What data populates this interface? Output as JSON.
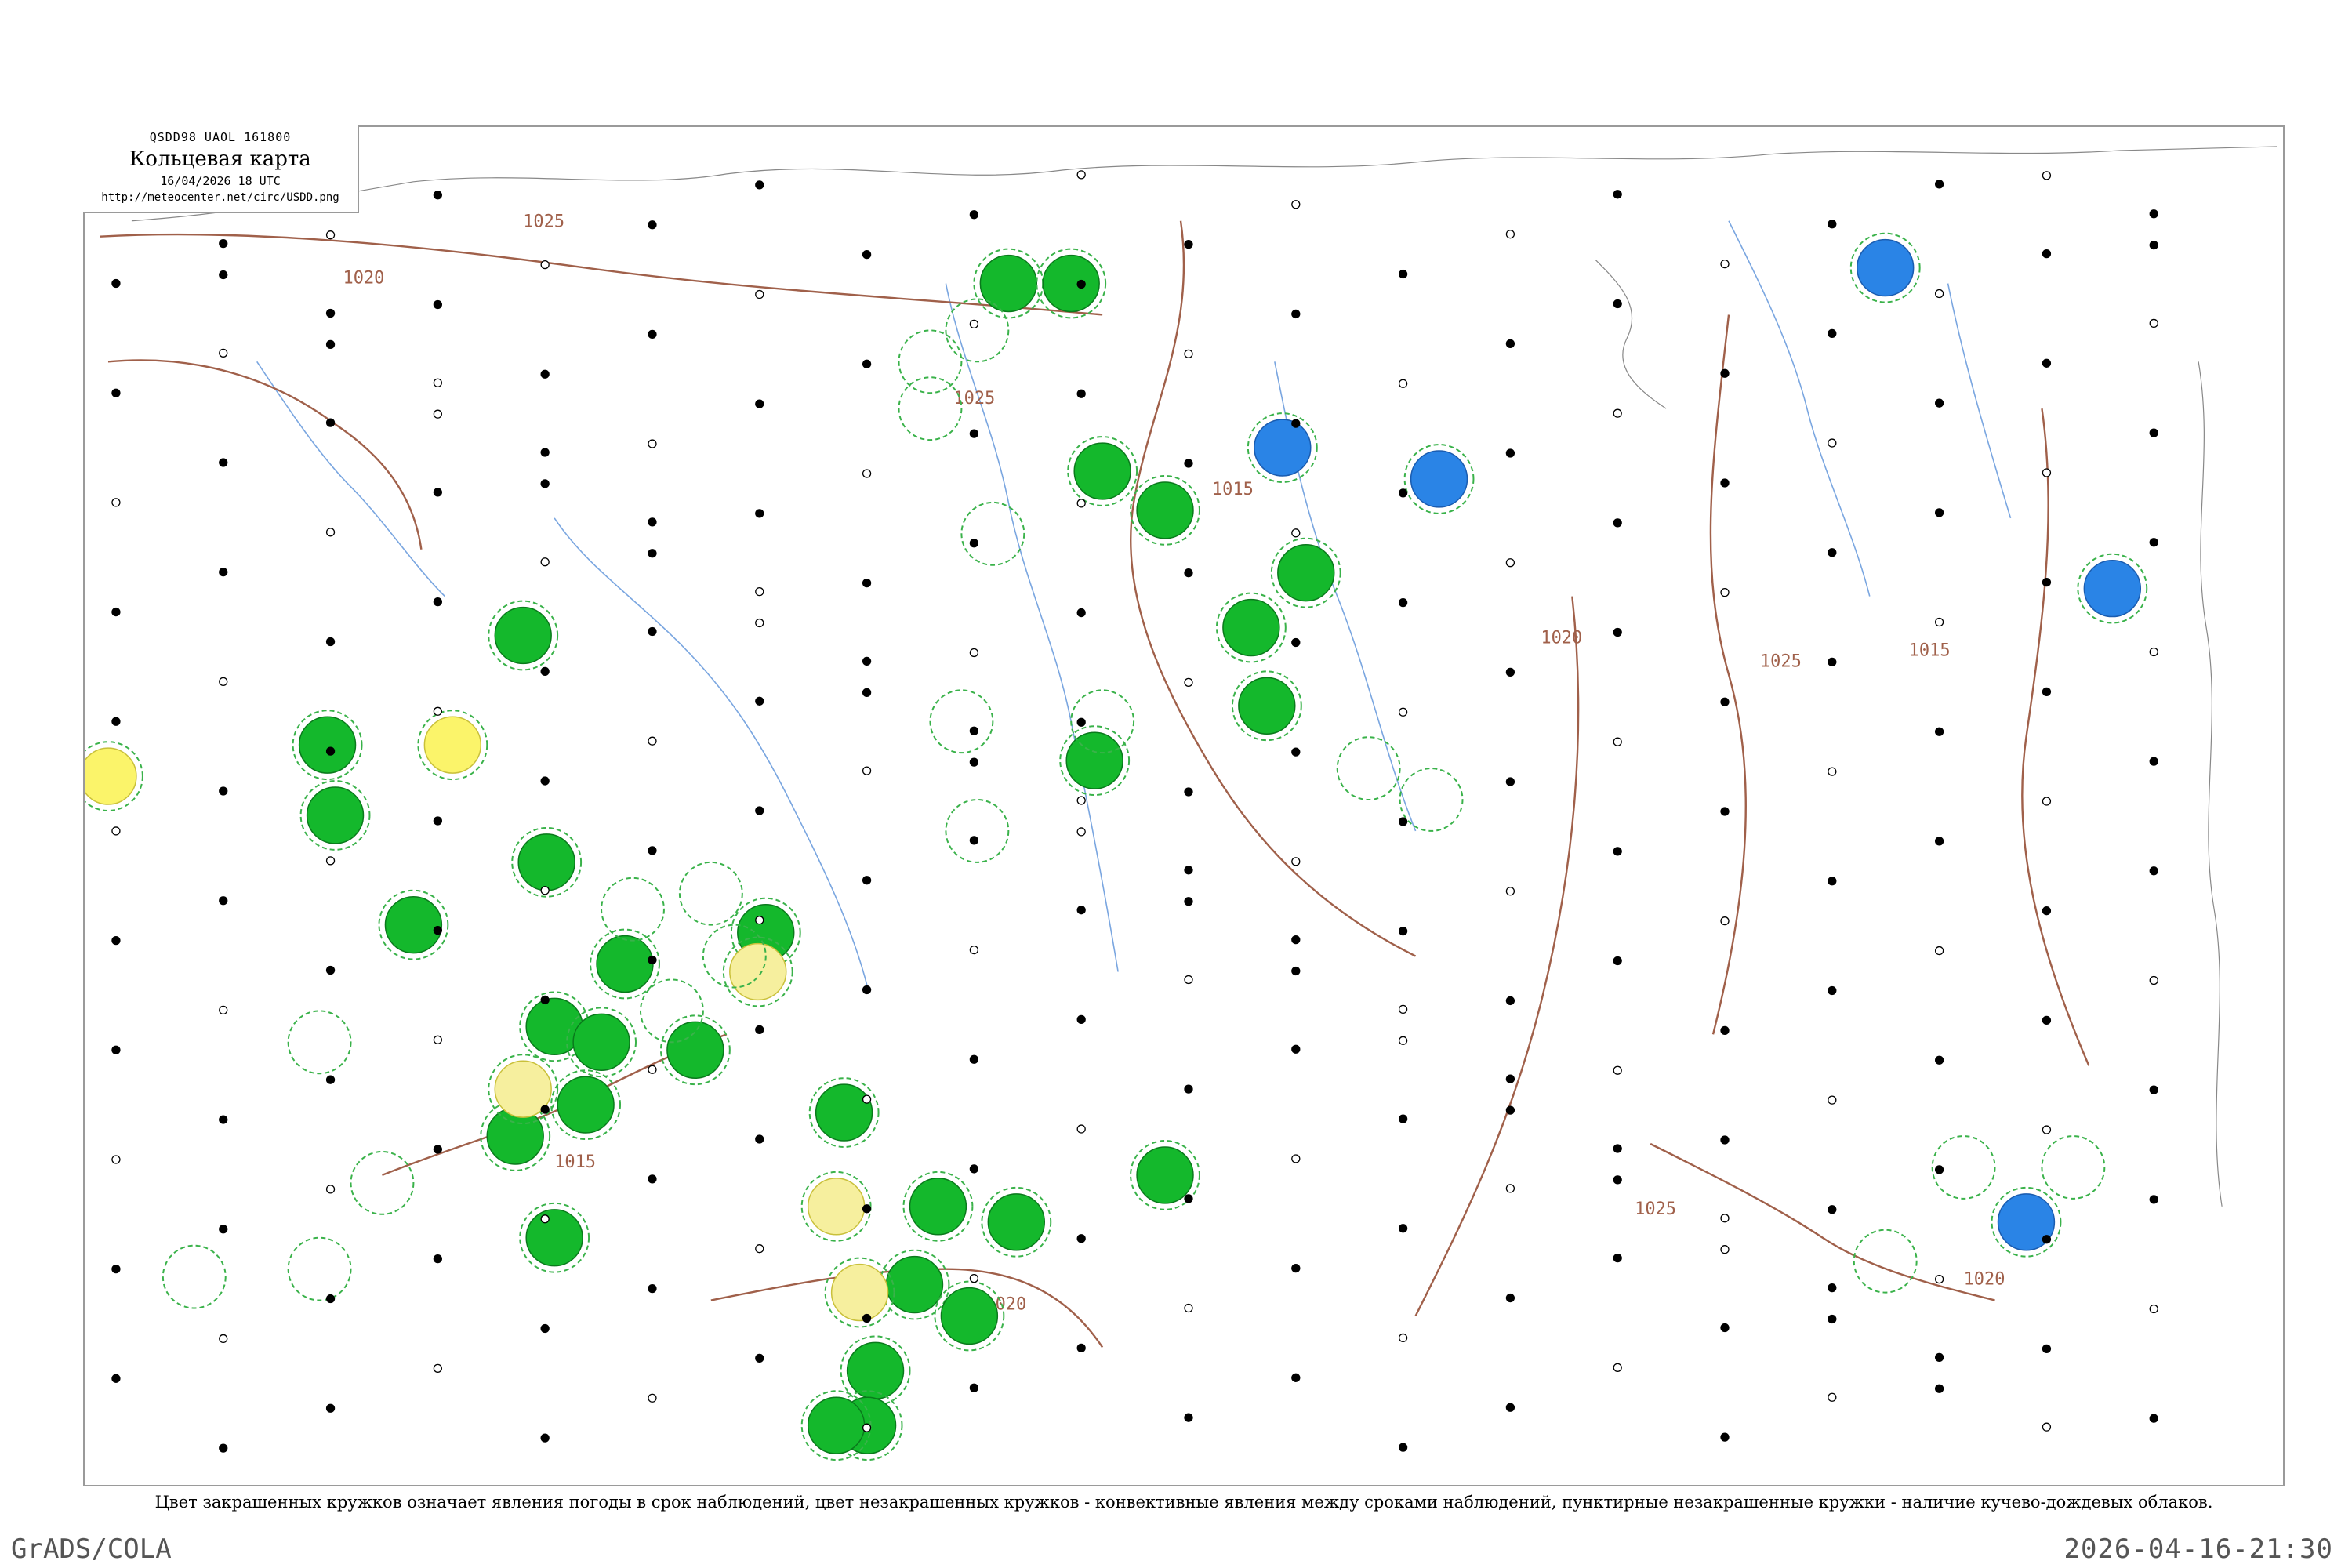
{
  "header": {
    "code": "QSDD98  UAOL  161800",
    "title": "Кольцевая карта",
    "datetime": "16/04/2026 18 UTC",
    "url": "http://meteocenter.net/circ/USDD.png"
  },
  "isobars": {
    "labels": [
      "1025",
      "1020",
      "1025",
      "1015",
      "1015",
      "1020",
      "1025",
      "1015",
      "1020",
      "1025",
      "1020"
    ]
  },
  "legend_caption": "Цвет закрашенных кружков означает явления погоды в срок наблюдений, цвет незакрашенных кружков - конвективные явления между сроками наблюдений, пунктирные незакрашенные кружки - наличие кучево-дождевых облаков.",
  "footer": {
    "left": "GrADS/COLA",
    "right": "2026-04-16-21:30"
  },
  "symbol_colors": {
    "rain": "#14b82c",
    "snow": "#2a84e6",
    "thunder": "#fbf46a",
    "drizzle": "#f6ef9e",
    "cb_ring": "#3ab24a",
    "isobar": "#a0604a"
  }
}
